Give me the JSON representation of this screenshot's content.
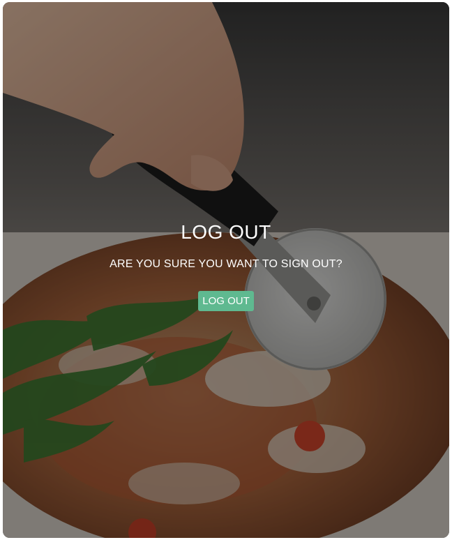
{
  "dialog": {
    "title": "LOG OUT",
    "message": "ARE YOU SURE YOU WANT TO SIGN OUT?",
    "logout_button_label": "LOG OUT"
  },
  "background": {
    "image_subject": "pizza-cutter-slicing-pizza-photo"
  },
  "colors": {
    "button_bg": "#5fb990",
    "text": "#ffffff",
    "overlay": "rgba(0,0,0,0.42)"
  }
}
